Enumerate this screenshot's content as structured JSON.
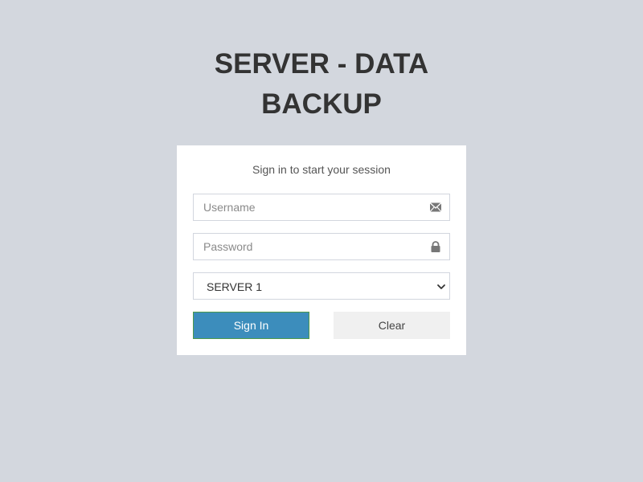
{
  "header": {
    "title_line1": "SERVER - DATA",
    "title_line2": "BACKUP"
  },
  "login": {
    "subtitle": "Sign in to start your session",
    "username": {
      "placeholder": "Username",
      "value": "",
      "icon": "envelope-icon"
    },
    "password": {
      "placeholder": "Password",
      "value": "",
      "icon": "lock-icon"
    },
    "server_select": {
      "selected": "SERVER 1"
    },
    "sign_in_label": "Sign In",
    "clear_label": "Clear"
  },
  "colors": {
    "background": "#d3d7de",
    "primary": "#3c8dbc",
    "secondary": "#f0f0f0"
  }
}
